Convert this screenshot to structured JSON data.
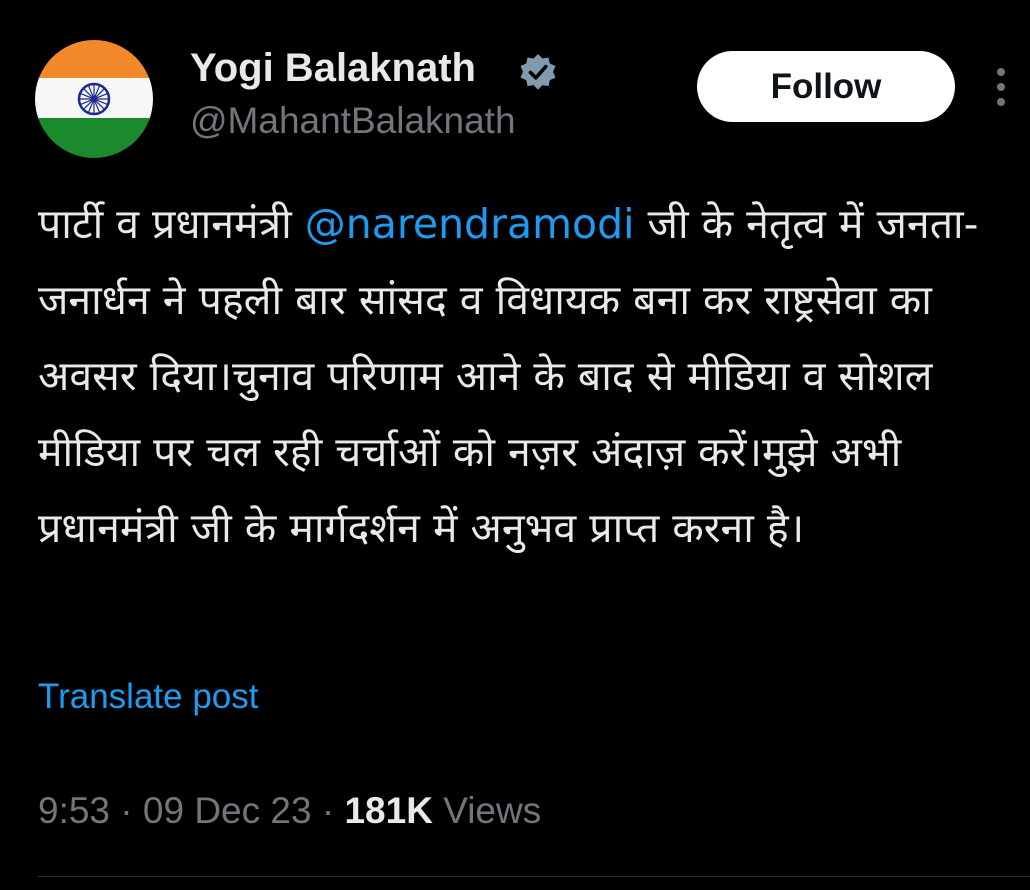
{
  "author": {
    "display_name": "Yogi Balaknath",
    "handle": "@MahantBalaknath",
    "avatar_icon": "indian-flag-avatar",
    "verified": true
  },
  "header": {
    "follow_label": "Follow",
    "more_icon": "more-vertical-icon"
  },
  "tweet": {
    "text_before_mention": "पार्टी व प्रधानमंत्री ",
    "mention": "@narendramodi",
    "text_after_mention": " जी के नेतृत्व में जनता-जनार्धन ने पहली बार सांसद व विधायक बना कर राष्ट्रसेवा का अवसर दिया।चुनाव परिणाम आने के बाद से मीडिया व सोशल मीडिया पर चल रही चर्चाओं को नज़र अंदाज़ करें।मुझे अभी प्रधानमंत्री जी के मार्गदर्शन में अनुभव प्राप्त करना है।",
    "translate_label": "Translate post"
  },
  "meta": {
    "time": "9:53",
    "separator": " · ",
    "date": "09 Dec 23",
    "views_count": "181K",
    "views_label": " Views"
  },
  "colors": {
    "background": "#000000",
    "text_primary": "#e7e9ea",
    "text_secondary": "#71767b",
    "link": "#1d9bf0",
    "follow_bg": "#ffffff",
    "follow_text": "#0f1419",
    "saffron": "#ff9933",
    "green": "#138808",
    "chakra_blue": "#000080"
  }
}
